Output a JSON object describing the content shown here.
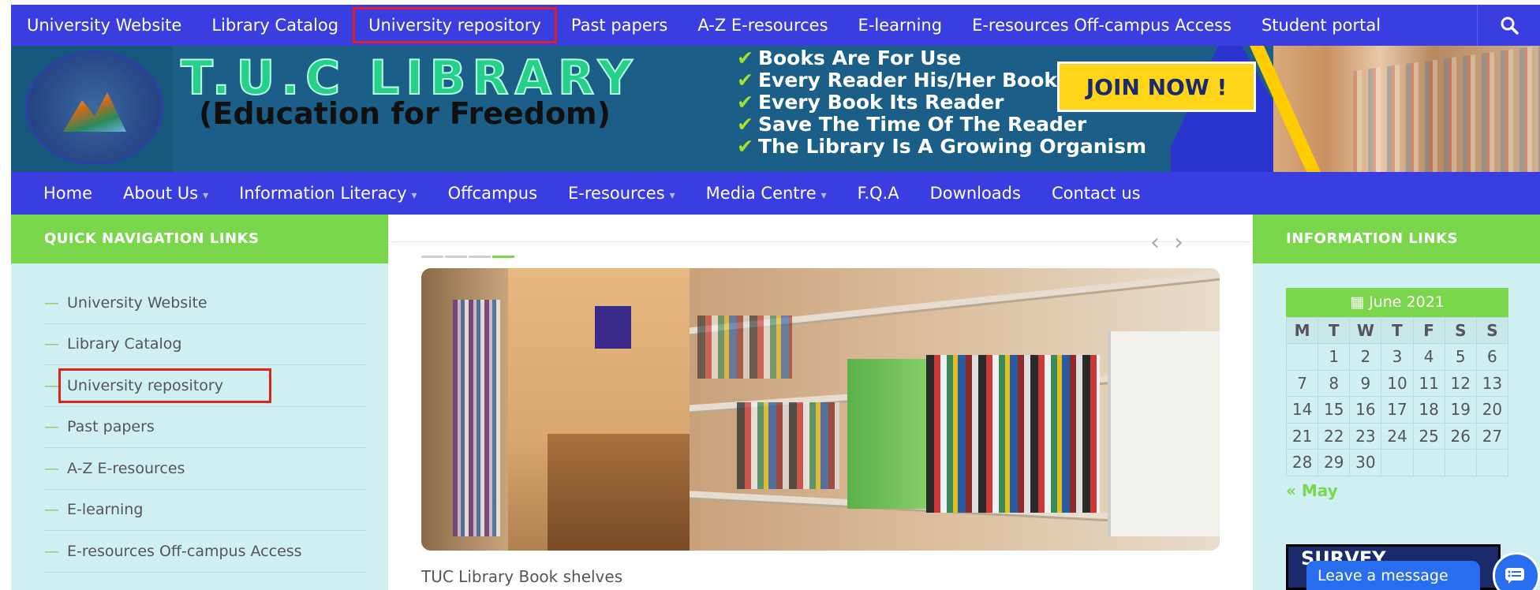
{
  "topbar": {
    "items": [
      {
        "label": "University Website"
      },
      {
        "label": "Library Catalog"
      },
      {
        "label": "University repository"
      },
      {
        "label": "Past papers"
      },
      {
        "label": "A-Z E-resources"
      },
      {
        "label": "E-learning"
      },
      {
        "label": "E-resources Off-campus Access"
      },
      {
        "label": "Student portal"
      }
    ],
    "search_icon": "search-icon"
  },
  "banner": {
    "title": "T.U.C LIBRARY",
    "subtitle": "(Education for Freedom)",
    "mottos": [
      "Books Are For Use",
      "Every Reader His/Her Book",
      "Every Book Its Reader",
      "Save The Time Of The Reader",
      "The Library Is A Growing Organism"
    ],
    "join_label": "JOIN NOW !"
  },
  "mainnav": {
    "items": [
      {
        "label": "Home",
        "caret": ""
      },
      {
        "label": "About Us",
        "caret": "▾"
      },
      {
        "label": "Information Literacy",
        "caret": "▾"
      },
      {
        "label": "Offcampus",
        "caret": ""
      },
      {
        "label": "E-resources",
        "caret": "▾"
      },
      {
        "label": "Media Centre",
        "caret": "▾"
      },
      {
        "label": "F.Q.A",
        "caret": ""
      },
      {
        "label": "Downloads",
        "caret": ""
      },
      {
        "label": "Contact us",
        "caret": ""
      }
    ]
  },
  "left_sidebar": {
    "heading": "QUICK NAVIGATION LINKS",
    "links": [
      {
        "label": "University Website"
      },
      {
        "label": "Library Catalog"
      },
      {
        "label": "University repository"
      },
      {
        "label": "Past papers"
      },
      {
        "label": "A-Z E-resources"
      },
      {
        "label": "E-learning"
      },
      {
        "label": "E-resources Off-campus Access"
      }
    ]
  },
  "slider": {
    "prev_icon": "chevron-left-icon",
    "next_icon": "chevron-right-icon",
    "caption": "TUC Library Book shelves"
  },
  "right_sidebar": {
    "heading": "INFORMATION LINKS",
    "calendar": {
      "icon": "calendar-icon",
      "title": "June 2021",
      "weekdays": [
        "M",
        "T",
        "W",
        "T",
        "F",
        "S",
        "S"
      ],
      "weeks": [
        [
          "",
          "1",
          "2",
          "3",
          "4",
          "5",
          "6"
        ],
        [
          "7",
          "8",
          "9",
          "10",
          "11",
          "12",
          "13"
        ],
        [
          "14",
          "15",
          "16",
          "17",
          "18",
          "19",
          "20"
        ],
        [
          "21",
          "22",
          "23",
          "24",
          "25",
          "26",
          "27"
        ],
        [
          "28",
          "29",
          "30",
          "",
          "",
          "",
          ""
        ]
      ],
      "prev_label": "« May"
    },
    "survey_label": "SURVEY"
  },
  "chat": {
    "label": "Leave a message",
    "icon": "chat-icon"
  },
  "colors": {
    "nav_blue": "#3a3de0",
    "green": "#7ad64a",
    "sidebar_bg": "#cfeff0",
    "highlight_red": "#e0221e"
  }
}
